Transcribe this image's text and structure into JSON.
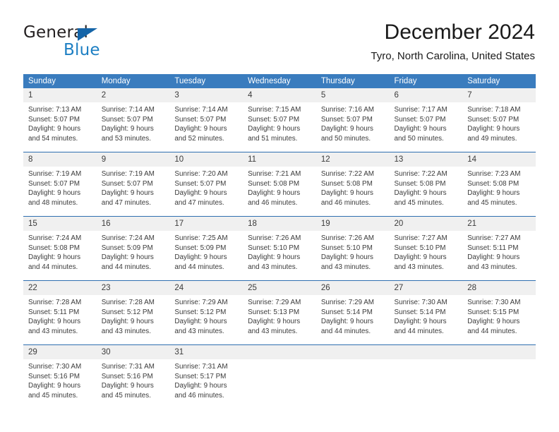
{
  "brand": {
    "name_top": "General",
    "name_bottom": "Blue",
    "triangle_color": "#1565a8",
    "blue_color": "#1d7fc3"
  },
  "header": {
    "title": "December 2024",
    "subtitle": "Tyro, North Carolina, United States"
  },
  "theme": {
    "header_blue": "#3a7cbe",
    "divider_blue": "#2f6fb0",
    "day_strip_gray": "#f0f0f0",
    "text_color": "#3b3b3b"
  },
  "calendar": {
    "weekday_headers": [
      "Sunday",
      "Monday",
      "Tuesday",
      "Wednesday",
      "Thursday",
      "Friday",
      "Saturday"
    ],
    "weeks": [
      [
        {
          "day": "1",
          "sunrise": "Sunrise: 7:13 AM",
          "sunset": "Sunset: 5:07 PM",
          "daylight1": "Daylight: 9 hours",
          "daylight2": "and 54 minutes."
        },
        {
          "day": "2",
          "sunrise": "Sunrise: 7:14 AM",
          "sunset": "Sunset: 5:07 PM",
          "daylight1": "Daylight: 9 hours",
          "daylight2": "and 53 minutes."
        },
        {
          "day": "3",
          "sunrise": "Sunrise: 7:14 AM",
          "sunset": "Sunset: 5:07 PM",
          "daylight1": "Daylight: 9 hours",
          "daylight2": "and 52 minutes."
        },
        {
          "day": "4",
          "sunrise": "Sunrise: 7:15 AM",
          "sunset": "Sunset: 5:07 PM",
          "daylight1": "Daylight: 9 hours",
          "daylight2": "and 51 minutes."
        },
        {
          "day": "5",
          "sunrise": "Sunrise: 7:16 AM",
          "sunset": "Sunset: 5:07 PM",
          "daylight1": "Daylight: 9 hours",
          "daylight2": "and 50 minutes."
        },
        {
          "day": "6",
          "sunrise": "Sunrise: 7:17 AM",
          "sunset": "Sunset: 5:07 PM",
          "daylight1": "Daylight: 9 hours",
          "daylight2": "and 50 minutes."
        },
        {
          "day": "7",
          "sunrise": "Sunrise: 7:18 AM",
          "sunset": "Sunset: 5:07 PM",
          "daylight1": "Daylight: 9 hours",
          "daylight2": "and 49 minutes."
        }
      ],
      [
        {
          "day": "8",
          "sunrise": "Sunrise: 7:19 AM",
          "sunset": "Sunset: 5:07 PM",
          "daylight1": "Daylight: 9 hours",
          "daylight2": "and 48 minutes."
        },
        {
          "day": "9",
          "sunrise": "Sunrise: 7:19 AM",
          "sunset": "Sunset: 5:07 PM",
          "daylight1": "Daylight: 9 hours",
          "daylight2": "and 47 minutes."
        },
        {
          "day": "10",
          "sunrise": "Sunrise: 7:20 AM",
          "sunset": "Sunset: 5:07 PM",
          "daylight1": "Daylight: 9 hours",
          "daylight2": "and 47 minutes."
        },
        {
          "day": "11",
          "sunrise": "Sunrise: 7:21 AM",
          "sunset": "Sunset: 5:08 PM",
          "daylight1": "Daylight: 9 hours",
          "daylight2": "and 46 minutes."
        },
        {
          "day": "12",
          "sunrise": "Sunrise: 7:22 AM",
          "sunset": "Sunset: 5:08 PM",
          "daylight1": "Daylight: 9 hours",
          "daylight2": "and 46 minutes."
        },
        {
          "day": "13",
          "sunrise": "Sunrise: 7:22 AM",
          "sunset": "Sunset: 5:08 PM",
          "daylight1": "Daylight: 9 hours",
          "daylight2": "and 45 minutes."
        },
        {
          "day": "14",
          "sunrise": "Sunrise: 7:23 AM",
          "sunset": "Sunset: 5:08 PM",
          "daylight1": "Daylight: 9 hours",
          "daylight2": "and 45 minutes."
        }
      ],
      [
        {
          "day": "15",
          "sunrise": "Sunrise: 7:24 AM",
          "sunset": "Sunset: 5:08 PM",
          "daylight1": "Daylight: 9 hours",
          "daylight2": "and 44 minutes."
        },
        {
          "day": "16",
          "sunrise": "Sunrise: 7:24 AM",
          "sunset": "Sunset: 5:09 PM",
          "daylight1": "Daylight: 9 hours",
          "daylight2": "and 44 minutes."
        },
        {
          "day": "17",
          "sunrise": "Sunrise: 7:25 AM",
          "sunset": "Sunset: 5:09 PM",
          "daylight1": "Daylight: 9 hours",
          "daylight2": "and 44 minutes."
        },
        {
          "day": "18",
          "sunrise": "Sunrise: 7:26 AM",
          "sunset": "Sunset: 5:10 PM",
          "daylight1": "Daylight: 9 hours",
          "daylight2": "and 43 minutes."
        },
        {
          "day": "19",
          "sunrise": "Sunrise: 7:26 AM",
          "sunset": "Sunset: 5:10 PM",
          "daylight1": "Daylight: 9 hours",
          "daylight2": "and 43 minutes."
        },
        {
          "day": "20",
          "sunrise": "Sunrise: 7:27 AM",
          "sunset": "Sunset: 5:10 PM",
          "daylight1": "Daylight: 9 hours",
          "daylight2": "and 43 minutes."
        },
        {
          "day": "21",
          "sunrise": "Sunrise: 7:27 AM",
          "sunset": "Sunset: 5:11 PM",
          "daylight1": "Daylight: 9 hours",
          "daylight2": "and 43 minutes."
        }
      ],
      [
        {
          "day": "22",
          "sunrise": "Sunrise: 7:28 AM",
          "sunset": "Sunset: 5:11 PM",
          "daylight1": "Daylight: 9 hours",
          "daylight2": "and 43 minutes."
        },
        {
          "day": "23",
          "sunrise": "Sunrise: 7:28 AM",
          "sunset": "Sunset: 5:12 PM",
          "daylight1": "Daylight: 9 hours",
          "daylight2": "and 43 minutes."
        },
        {
          "day": "24",
          "sunrise": "Sunrise: 7:29 AM",
          "sunset": "Sunset: 5:12 PM",
          "daylight1": "Daylight: 9 hours",
          "daylight2": "and 43 minutes."
        },
        {
          "day": "25",
          "sunrise": "Sunrise: 7:29 AM",
          "sunset": "Sunset: 5:13 PM",
          "daylight1": "Daylight: 9 hours",
          "daylight2": "and 43 minutes."
        },
        {
          "day": "26",
          "sunrise": "Sunrise: 7:29 AM",
          "sunset": "Sunset: 5:14 PM",
          "daylight1": "Daylight: 9 hours",
          "daylight2": "and 44 minutes."
        },
        {
          "day": "27",
          "sunrise": "Sunrise: 7:30 AM",
          "sunset": "Sunset: 5:14 PM",
          "daylight1": "Daylight: 9 hours",
          "daylight2": "and 44 minutes."
        },
        {
          "day": "28",
          "sunrise": "Sunrise: 7:30 AM",
          "sunset": "Sunset: 5:15 PM",
          "daylight1": "Daylight: 9 hours",
          "daylight2": "and 44 minutes."
        }
      ],
      [
        {
          "day": "29",
          "sunrise": "Sunrise: 7:30 AM",
          "sunset": "Sunset: 5:16 PM",
          "daylight1": "Daylight: 9 hours",
          "daylight2": "and 45 minutes."
        },
        {
          "day": "30",
          "sunrise": "Sunrise: 7:31 AM",
          "sunset": "Sunset: 5:16 PM",
          "daylight1": "Daylight: 9 hours",
          "daylight2": "and 45 minutes."
        },
        {
          "day": "31",
          "sunrise": "Sunrise: 7:31 AM",
          "sunset": "Sunset: 5:17 PM",
          "daylight1": "Daylight: 9 hours",
          "daylight2": "and 46 minutes."
        },
        {
          "day": "",
          "sunrise": "",
          "sunset": "",
          "daylight1": "",
          "daylight2": ""
        },
        {
          "day": "",
          "sunrise": "",
          "sunset": "",
          "daylight1": "",
          "daylight2": ""
        },
        {
          "day": "",
          "sunrise": "",
          "sunset": "",
          "daylight1": "",
          "daylight2": ""
        },
        {
          "day": "",
          "sunrise": "",
          "sunset": "",
          "daylight1": "",
          "daylight2": ""
        }
      ]
    ]
  }
}
